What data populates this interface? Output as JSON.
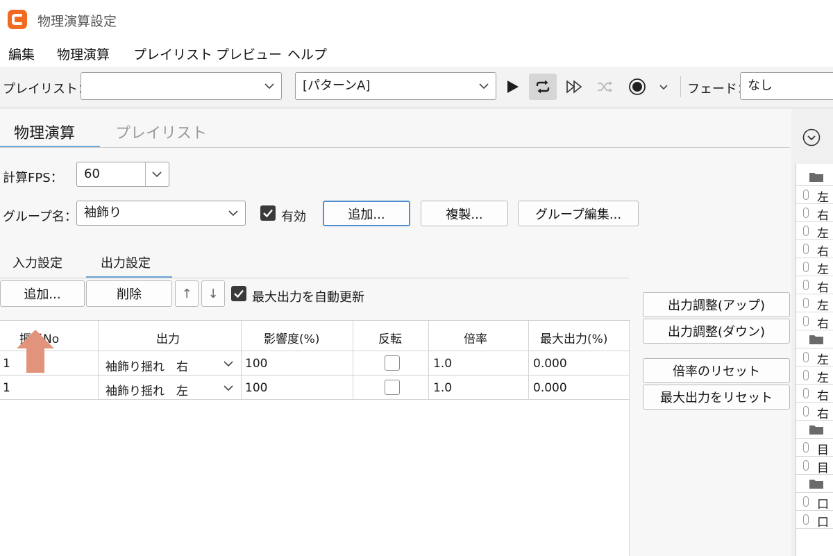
{
  "window": {
    "title": "物理演算設定"
  },
  "menu": [
    "編集",
    "物理演算",
    "プレイリスト",
    "プレビュー",
    "ヘルプ"
  ],
  "toolbar": {
    "playlist_label": "プレイリスト：",
    "playlist_value": "",
    "pattern_value": "[パターンA]",
    "fade_label": "フェード：",
    "fade_value": "なし"
  },
  "tabs": {
    "physics": "物理演算",
    "playlist": "プレイリスト"
  },
  "fps": {
    "label": "計算FPS：",
    "value": "60"
  },
  "group": {
    "label": "グループ名：",
    "value": "袖飾り",
    "enabled_label": "有効",
    "enabled": true,
    "add": "追加...",
    "duplicate": "複製...",
    "edit": "グループ編集..."
  },
  "subtabs": {
    "input": "入力設定",
    "output": "出力設定"
  },
  "output_toolbar": {
    "add": "追加...",
    "delete": "削除",
    "up": "↑",
    "down": "↓",
    "auto_update_label": "最大出力を自動更新",
    "auto_update": true
  },
  "table": {
    "columns": [
      "振子No",
      "出力",
      "影響度(%)",
      "反転",
      "倍率",
      "最大出力(%)"
    ],
    "rows": [
      {
        "no": "1",
        "output": "袖飾り揺れ　右",
        "influence": "100",
        "invert": false,
        "scale": "1.0",
        "max": "0.000"
      },
      {
        "no": "1",
        "output": "袖飾り揺れ　左",
        "influence": "100",
        "invert": false,
        "scale": "1.0",
        "max": "0.000"
      }
    ]
  },
  "side_buttons": {
    "adjust_up": "出力調整(アップ)",
    "adjust_down": "出力調整(ダウン)",
    "reset_scale": "倍率のリセット",
    "reset_max": "最大出力をリセット"
  },
  "strip": [
    {
      "type": "folder"
    },
    {
      "type": "item",
      "text": "左"
    },
    {
      "type": "item",
      "text": "右"
    },
    {
      "type": "item",
      "text": "左"
    },
    {
      "type": "item",
      "text": "右"
    },
    {
      "type": "item",
      "text": "左"
    },
    {
      "type": "item",
      "text": "右"
    },
    {
      "type": "item",
      "text": "左"
    },
    {
      "type": "item",
      "text": "右"
    },
    {
      "type": "folder"
    },
    {
      "type": "item",
      "text": "左"
    },
    {
      "type": "item",
      "text": "左"
    },
    {
      "type": "item",
      "text": "右"
    },
    {
      "type": "item",
      "text": "右"
    },
    {
      "type": "folder"
    },
    {
      "type": "item",
      "text": "目"
    },
    {
      "type": "item",
      "text": "目"
    },
    {
      "type": "folder"
    },
    {
      "type": "item",
      "text": "口"
    },
    {
      "type": "item",
      "text": "口"
    }
  ],
  "colors": {
    "accent": "#6fa6d6",
    "brand": "#f26a21",
    "arrow": "#e2937c"
  }
}
